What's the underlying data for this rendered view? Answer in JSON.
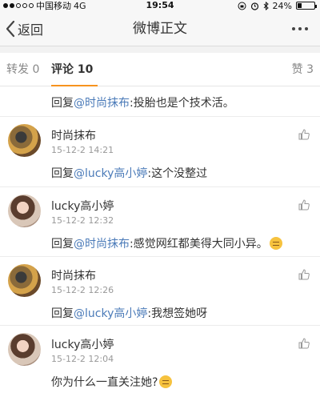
{
  "status_bar": {
    "carrier": "中国移动",
    "network": "4G",
    "time": "19:54",
    "battery": "24%",
    "battery_level": 0.24
  },
  "nav": {
    "back_label": "返回",
    "title": "微博正文"
  },
  "tabs": {
    "repost": "转发 0",
    "comment": "评论 10",
    "like": "赞 3"
  },
  "comments": [
    {
      "reply_prefix": "回复",
      "mention": "@时尚抹布",
      "text": ":投胎也是个技术活。"
    },
    {
      "name": "时尚抹布",
      "time": "15-12-2 14:21",
      "reply_prefix": "回复",
      "mention": "@lucky高小婷",
      "text": ":这个没整过"
    },
    {
      "name": "lucky高小婷",
      "time": "15-12-2 12:32",
      "reply_prefix": "回复",
      "mention": "@时尚抹布",
      "text": ":感觉网红都美得大同小异。",
      "emoji": "disappointed-emoji"
    },
    {
      "name": "时尚抹布",
      "time": "15-12-2 12:26",
      "reply_prefix": "回复",
      "mention": "@lucky高小婷",
      "text": ":我想签她呀"
    },
    {
      "name": "lucky高小婷",
      "time": "15-12-2 12:04",
      "text": "你为什么一直关注她?",
      "emoji": "thinking-emoji"
    }
  ],
  "colors": {
    "accent": "#f7931e",
    "mention": "#4a7ab8",
    "nav_bg": "#f7f7f7"
  }
}
